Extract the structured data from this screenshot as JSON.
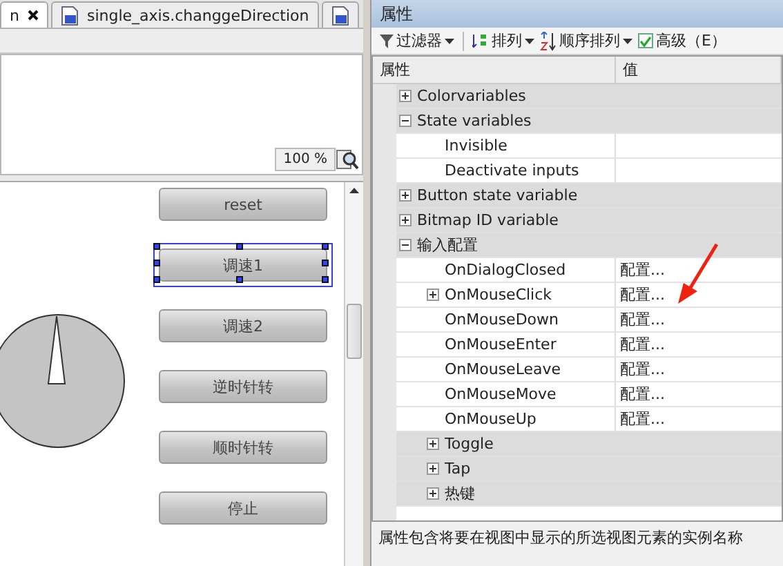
{
  "editor": {
    "tabs": [
      {
        "label": "n",
        "selected": true,
        "closable": true
      },
      {
        "label": "single_axis.changgeDirection",
        "selected": false,
        "closable": false
      },
      {
        "selected": false,
        "closable": false
      }
    ],
    "zoom": "100 %",
    "buttons": [
      {
        "label": "reset",
        "selected": false
      },
      {
        "label": "调速1",
        "selected": true
      },
      {
        "label": "调速2",
        "selected": false
      },
      {
        "label": "逆时针转",
        "selected": false
      },
      {
        "label": "顺时针转",
        "selected": false
      },
      {
        "label": "停止",
        "selected": false
      }
    ]
  },
  "properties": {
    "title": "属性",
    "toolbar": [
      {
        "kind": "dropdown",
        "label": "过滤器"
      },
      {
        "kind": "dropdown",
        "label": "排列"
      },
      {
        "kind": "dropdown",
        "label": "顺序排列"
      },
      {
        "kind": "checkbox",
        "label": "高级（E）",
        "checked": true
      }
    ],
    "columns": [
      "属性",
      "值"
    ],
    "rows": [
      {
        "kind": "category",
        "name": "Colorvariables",
        "expanded": false
      },
      {
        "kind": "category",
        "name": "State variables",
        "expanded": true,
        "children": [
          {
            "kind": "property",
            "name": "Invisible"
          },
          {
            "kind": "property",
            "name": "Deactivate inputs"
          }
        ]
      },
      {
        "kind": "category",
        "name": "Button state variable",
        "expanded": false
      },
      {
        "kind": "category",
        "name": "Bitmap ID variable",
        "expanded": false
      },
      {
        "kind": "category",
        "name": "输入配置",
        "expanded": true,
        "children": [
          {
            "kind": "property",
            "name": "OnDialogClosed",
            "value": "配置..."
          },
          {
            "kind": "property",
            "name": "OnMouseClick",
            "value": "配置...",
            "expanded": false
          },
          {
            "kind": "property",
            "name": "OnMouseDown",
            "value": "配置..."
          },
          {
            "kind": "property",
            "name": "OnMouseEnter",
            "value": "配置..."
          },
          {
            "kind": "property",
            "name": "OnMouseLeave",
            "value": "配置..."
          },
          {
            "kind": "property",
            "name": "OnMouseMove",
            "value": "配置..."
          },
          {
            "kind": "property",
            "name": "OnMouseUp",
            "value": "配置..."
          },
          {
            "kind": "category",
            "name": "Toggle",
            "expanded": false
          },
          {
            "kind": "category",
            "name": "Tap",
            "expanded": false
          },
          {
            "kind": "category",
            "name": "热键",
            "expanded": false
          }
        ]
      }
    ],
    "description": "属性包含将要在视图中显示的所选视图元素的实例名称"
  }
}
